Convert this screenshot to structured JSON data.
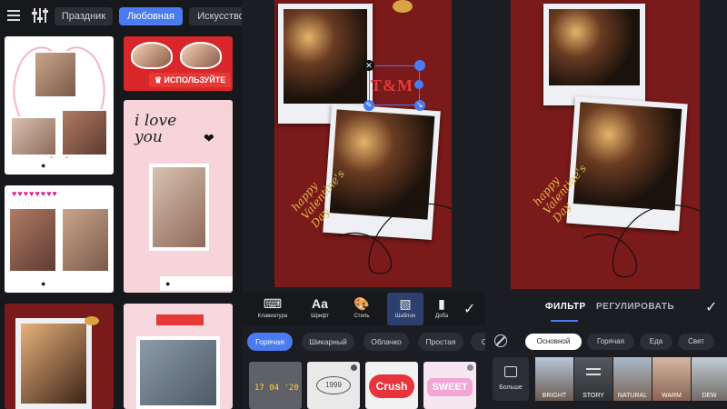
{
  "left_panel": {
    "tabs": [
      {
        "label": "Праздник",
        "active": false
      },
      {
        "label": "Любовная",
        "active": true
      },
      {
        "label": "Искусство",
        "active": false
      }
    ],
    "use_label": "ИСПОЛЬЗУЙТЕ",
    "card2_text": "i love you",
    "accent_color": "#4a7bf0",
    "badge_red_color": "#e53935"
  },
  "editor": {
    "sticker_text": "T&M",
    "caption": "happy Valentine's Day",
    "toolbar": [
      {
        "icon": "keyboard-icon",
        "label": "Клавиатура"
      },
      {
        "icon": "font-icon",
        "label": "Шрифт",
        "glyph": "Aa"
      },
      {
        "icon": "palette-icon",
        "label": "Стиль"
      },
      {
        "icon": "template-icon",
        "label": "Шаблон",
        "active": true
      },
      {
        "icon": "add-icon",
        "label": "Доба"
      }
    ],
    "categories": [
      {
        "label": "Горячая",
        "active": true
      },
      {
        "label": "Шикарный",
        "active": false
      },
      {
        "label": "Облачко",
        "active": false
      },
      {
        "label": "Простая",
        "active": false
      },
      {
        "label": "С",
        "active": false
      }
    ],
    "templates": [
      {
        "text": "17 04 '20"
      },
      {
        "text": "1999"
      },
      {
        "text": "Crush"
      },
      {
        "text": "SWEET"
      }
    ]
  },
  "filter_panel": {
    "tabs": [
      {
        "label": "ФИЛЬТР",
        "active": true
      },
      {
        "label": "РЕГУЛИРОВАТЬ",
        "active": false
      }
    ],
    "categories": [
      {
        "label": "Основной",
        "active": true
      },
      {
        "label": "Горячая",
        "active": false
      },
      {
        "label": "Еда",
        "active": false
      },
      {
        "label": "Свет",
        "active": false
      }
    ],
    "more_label": "Больше",
    "filters": [
      {
        "label": "BRIGHT"
      },
      {
        "label": "STORY",
        "selected": true
      },
      {
        "label": "NATURAL"
      },
      {
        "label": "WARM"
      },
      {
        "label": "DEW"
      }
    ]
  }
}
